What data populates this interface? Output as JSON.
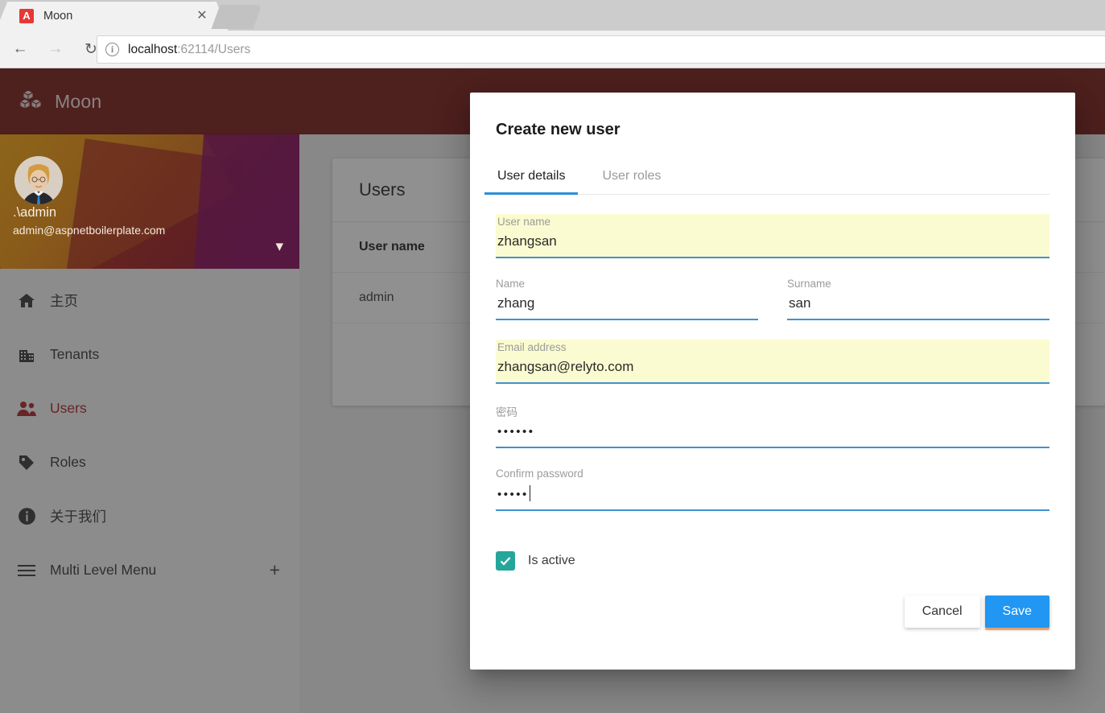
{
  "browser": {
    "tab": {
      "title": "Moon",
      "favicon_letter": "A",
      "favicon_color": "#e53935",
      "close_icon": "close-icon"
    },
    "back_icon": "back-arrow-icon",
    "forward_icon": "forward-arrow-icon",
    "reload_icon": "reload-icon",
    "site_info_icon": "info-circle-icon",
    "url_host": "localhost",
    "url_rest": ":62114/Users"
  },
  "app": {
    "brand": {
      "name": "Moon",
      "logo_icon": "cubes-logo-icon",
      "header_color": "#7B1E1A"
    },
    "profile": {
      "avatar_icon": "user-avatar",
      "name": ".\\admin",
      "email": "admin@aspnetboilerplate.com",
      "expand_icon": "chevron-down-icon"
    },
    "nav": [
      {
        "label": "主页",
        "icon": "home-icon",
        "active": false
      },
      {
        "label": "Tenants",
        "icon": "building-icon",
        "active": false
      },
      {
        "label": "Users",
        "icon": "users-icon",
        "active": true
      },
      {
        "label": "Roles",
        "icon": "tag-icon",
        "active": false
      },
      {
        "label": "关于我们",
        "icon": "info-icon",
        "active": false
      },
      {
        "label": "Multi Level Menu",
        "icon": "menu-icon",
        "active": false,
        "expander": "+"
      }
    ],
    "users_card": {
      "title": "Users",
      "columns": [
        "User name"
      ],
      "rows": [
        [
          "admin"
        ]
      ]
    }
  },
  "modal": {
    "title": "Create new user",
    "tabs": [
      {
        "label": "User details",
        "active": true
      },
      {
        "label": "User roles",
        "active": false
      }
    ],
    "accent_color": "#2b8fd6",
    "autofill_color": "#fbfbd1",
    "fields": {
      "username": {
        "label": "User name",
        "value": "zhangsan",
        "autofilled": true
      },
      "name": {
        "label": "Name",
        "value": "zhang",
        "autofilled": false
      },
      "surname": {
        "label": "Surname",
        "value": "san",
        "autofilled": false
      },
      "email": {
        "label": "Email address",
        "value": "zhangsan@relyto.com",
        "autofilled": true
      },
      "password": {
        "label": "密码",
        "value": "••••••",
        "autofilled": false
      },
      "confirm": {
        "label": "Confirm password",
        "value": "•••••",
        "autofilled": false,
        "focused": true
      }
    },
    "is_active": {
      "label": "Is active",
      "checked": true,
      "color": "#26A69A"
    },
    "buttons": {
      "cancel": "Cancel",
      "save": "Save",
      "save_color": "#2196F3"
    }
  }
}
